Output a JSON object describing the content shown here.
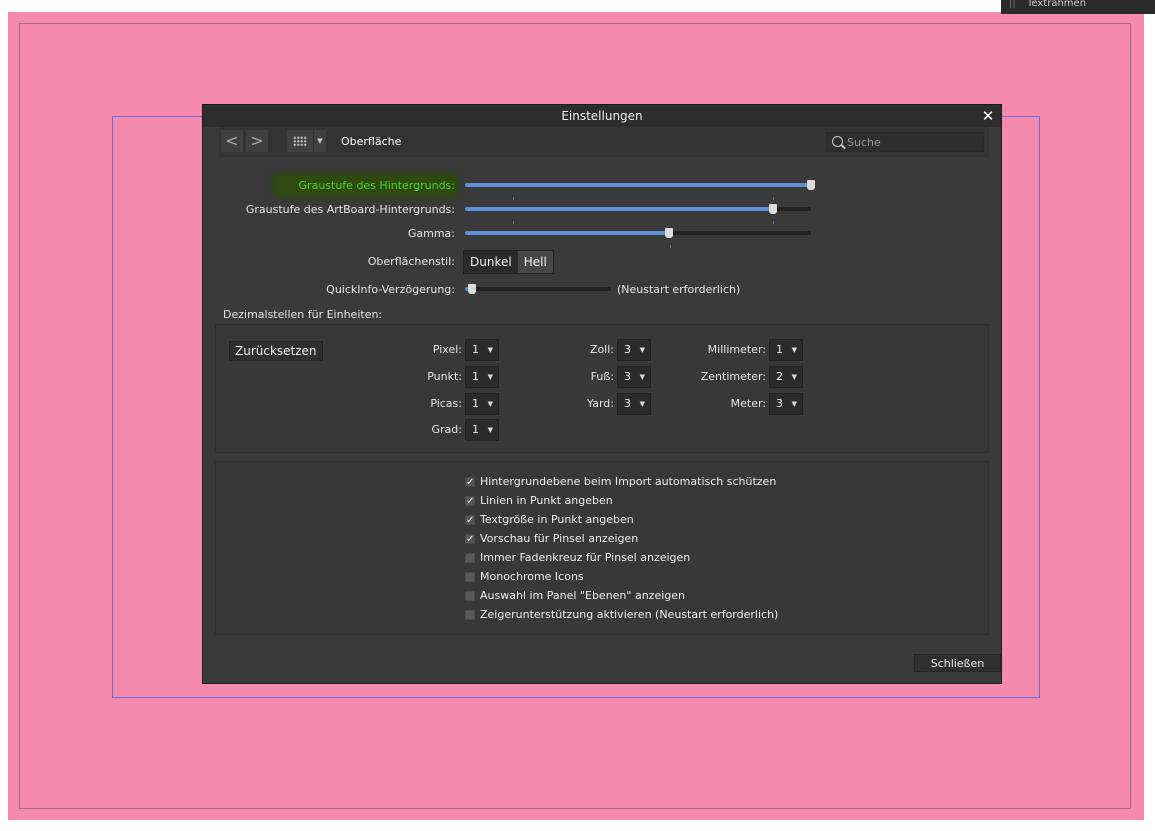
{
  "top_panel": {
    "label": "Textrahmen"
  },
  "dialog": {
    "title": "Einstellungen",
    "close_icon": "close-icon"
  },
  "toolbar": {
    "back_icon": "<",
    "forward_icon": ">",
    "breadcrumb": "Oberfläche",
    "search_placeholder": "Suche"
  },
  "sliders": [
    {
      "label": "Graustufe des Hintergrunds:",
      "value": 1.0,
      "highlighted": true
    },
    {
      "label": "Graustufe des ArtBoard-Hintergrunds:",
      "value": 0.89
    },
    {
      "label": "Gamma:",
      "value": 0.59
    }
  ],
  "ui_style": {
    "label": "Oberflächenstil:",
    "options": [
      "Dunkel",
      "Hell"
    ],
    "selected": "Dunkel"
  },
  "tooltip_delay": {
    "label": "QuickInfo-Verzögerung:",
    "value": 0.05,
    "note": "(Neustart erforderlich)"
  },
  "decimals": {
    "title": "Dezimalstellen für Einheiten:",
    "reset_label": "Zurücksetzen",
    "units": [
      {
        "label": "Pixel:",
        "value": "1"
      },
      {
        "label": "Punkt:",
        "value": "1"
      },
      {
        "label": "Picas:",
        "value": "1"
      },
      {
        "label": "Grad:",
        "value": "1"
      },
      {
        "label": "Zoll:",
        "value": "3"
      },
      {
        "label": "Fuß:",
        "value": "3"
      },
      {
        "label": "Yard:",
        "value": "3"
      },
      {
        "label": "Millimeter:",
        "value": "1"
      },
      {
        "label": "Zentimeter:",
        "value": "2"
      },
      {
        "label": "Meter:",
        "value": "3"
      }
    ]
  },
  "options": [
    {
      "label": "Hintergrundebene beim Import automatisch schützen",
      "checked": true
    },
    {
      "label": "Linien in Punkt angeben",
      "checked": true
    },
    {
      "label": "Textgröße in Punkt angeben",
      "checked": true
    },
    {
      "label": "Vorschau für Pinsel anzeigen",
      "checked": true
    },
    {
      "label": "Immer Fadenkreuz für Pinsel anzeigen",
      "checked": false
    },
    {
      "label": "Monochrome Icons",
      "checked": false
    },
    {
      "label": "Auswahl im Panel \"Ebenen\" anzeigen",
      "checked": false
    },
    {
      "label": "Zeigerunterstützung aktivieren (Neustart erforderlich)",
      "checked": false
    }
  ],
  "footer": {
    "close_label": "Schließen"
  },
  "colors": {
    "canvas": "#f589ae",
    "dialog_bg": "#3a3a3a",
    "accent": "#5b8fd8",
    "highlight_text": "#4cd636"
  }
}
